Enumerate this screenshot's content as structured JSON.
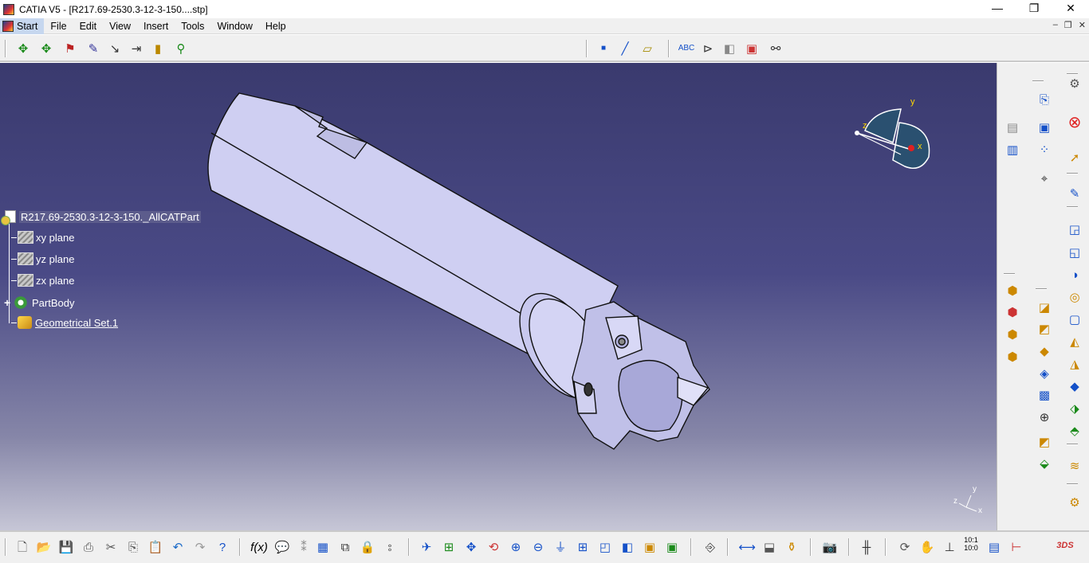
{
  "window": {
    "title": "CATIA V5 - [R217.69-2530.3-12-3-150....stp]",
    "minimize": "—",
    "maximize": "❐",
    "close": "✕"
  },
  "menu": {
    "start": "Start",
    "items": [
      {
        "label": "File"
      },
      {
        "label": "Edit"
      },
      {
        "label": "View"
      },
      {
        "label": "Insert"
      },
      {
        "label": "Tools"
      },
      {
        "label": "Window"
      },
      {
        "label": "Help"
      }
    ],
    "mdi": {
      "minimize": "–",
      "restore": "❐",
      "close": "✕"
    }
  },
  "tree": {
    "root": "R217.69-2530.3-12-3-150._AllCATPart",
    "planes": [
      "xy plane",
      "yz plane",
      "zx plane"
    ],
    "body": "PartBody",
    "geoset": "Geometrical Set.1"
  },
  "compass": {
    "x": "x",
    "y": "y",
    "z": "z"
  },
  "axis_triad": {
    "x": "x",
    "y": "y",
    "z": "z"
  },
  "bottom_toolbar": {
    "zoom_scale_top": "10:1",
    "zoom_scale_bottom": "10:0"
  },
  "colors": {
    "viewport_top": "#3a3a6e",
    "viewport_bottom": "#c6c6d6",
    "part_fill": "#cfcff2",
    "accent_red": "#e02020"
  }
}
